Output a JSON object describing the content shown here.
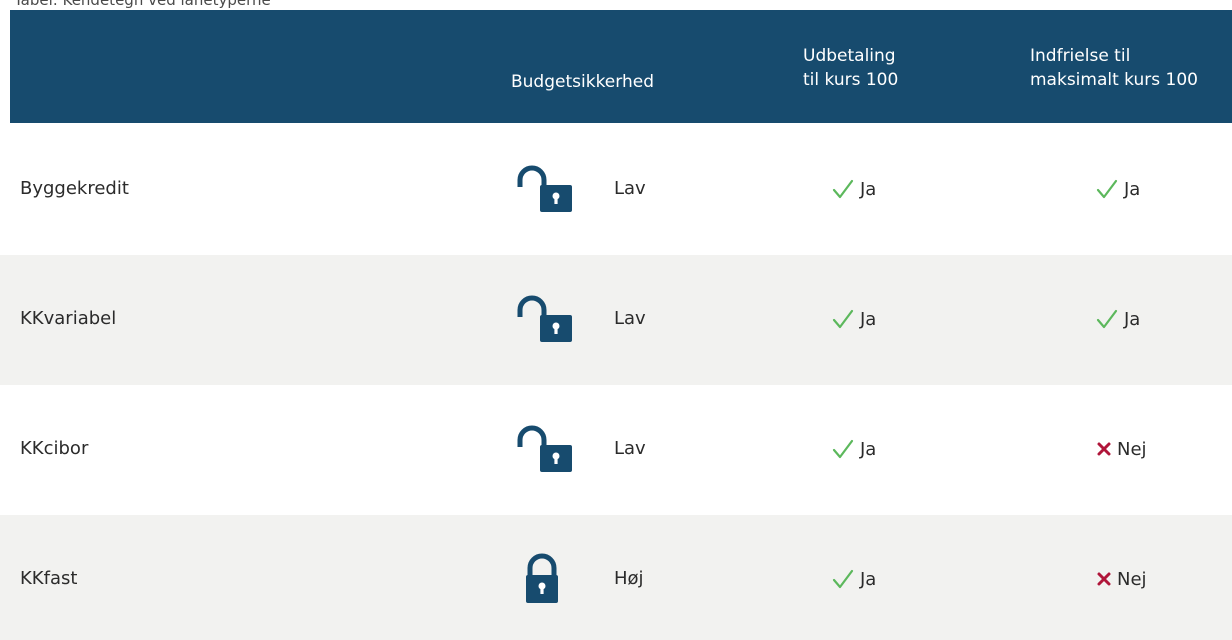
{
  "cut_caption": "Tabel: Kendetegn ved lånetyperne",
  "header": {
    "budget": [
      "Budgetsikkerhed"
    ],
    "udbetaling": [
      "Udbetaling",
      "til kurs 100"
    ],
    "indfrielse": [
      "Indfrielse til",
      "maksimalt kurs 100"
    ]
  },
  "colors": {
    "header_bg": "#174b6e",
    "lock": "#174b6e",
    "check": "#5cb85c",
    "cross": "#b0163a",
    "row_alt": "#f2f2f0"
  },
  "rows": [
    {
      "name": "Byggekredit",
      "lock_icon": "unlocked-padlock-icon",
      "level": "Lav",
      "udbetaling": {
        "icon": "check-icon",
        "text": "Ja"
      },
      "indfrielse": {
        "icon": "check-icon",
        "text": "Ja"
      }
    },
    {
      "name": "KKvariabel",
      "lock_icon": "unlocked-padlock-icon",
      "level": "Lav",
      "udbetaling": {
        "icon": "check-icon",
        "text": "Ja"
      },
      "indfrielse": {
        "icon": "check-icon",
        "text": "Ja"
      }
    },
    {
      "name": "KKcibor",
      "lock_icon": "unlocked-padlock-icon",
      "level": "Lav",
      "udbetaling": {
        "icon": "check-icon",
        "text": "Ja"
      },
      "indfrielse": {
        "icon": "cross-icon",
        "text": "Nej"
      }
    },
    {
      "name": "KKfast",
      "lock_icon": "locked-padlock-icon",
      "level": "Høj",
      "udbetaling": {
        "icon": "check-icon",
        "text": "Ja"
      },
      "indfrielse": {
        "icon": "cross-icon",
        "text": "Nej"
      }
    }
  ]
}
